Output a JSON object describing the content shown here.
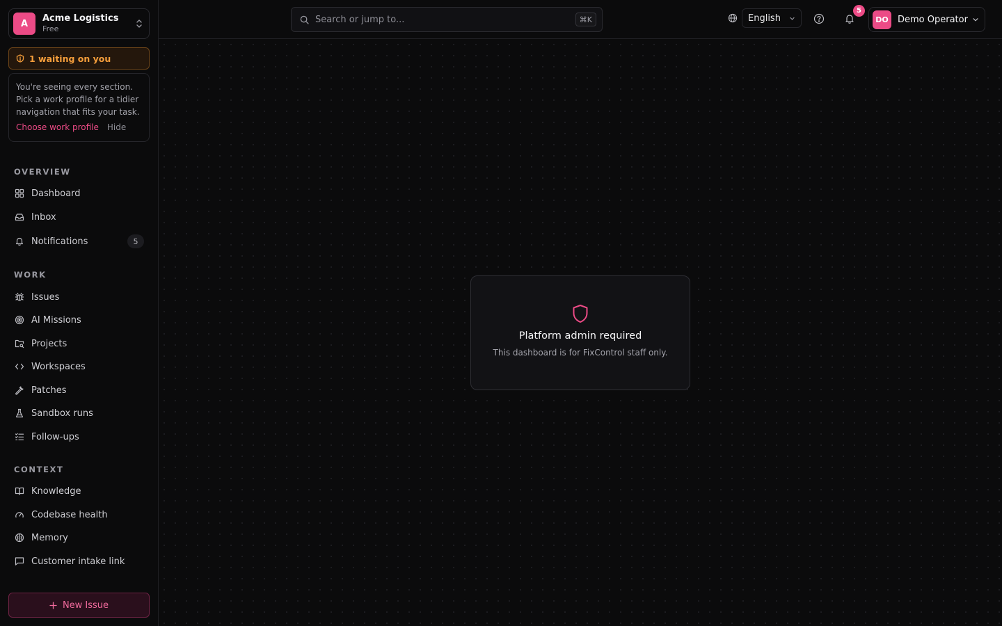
{
  "org": {
    "initial": "A",
    "name": "Acme Logistics",
    "plan": "Free"
  },
  "waiting": {
    "label": "1 waiting on you"
  },
  "profile_card": {
    "text": "You're seeing every section. Pick a work profile for a tidier navigation that fits your task.",
    "choose_label": "Choose work profile",
    "hide_label": "Hide"
  },
  "sections": {
    "overview": "OVERVIEW",
    "work": "WORK",
    "context": "CONTEXT"
  },
  "nav": {
    "dashboard": "Dashboard",
    "inbox": "Inbox",
    "notifications": "Notifications",
    "notifications_count": "5",
    "issues": "Issues",
    "ai_missions": "AI Missions",
    "projects": "Projects",
    "workspaces": "Workspaces",
    "patches": "Patches",
    "sandbox_runs": "Sandbox runs",
    "follow_ups": "Follow-ups",
    "knowledge": "Knowledge",
    "codebase_health": "Codebase health",
    "memory": "Memory",
    "customer_intake_link": "Customer intake link"
  },
  "new_issue": {
    "label": "New Issue"
  },
  "topbar": {
    "search_placeholder": "Search or jump to...",
    "search_shortcut": "⌘K",
    "language": "English",
    "notification_badge": "5",
    "user_initials": "DO",
    "user_name": "Demo Operator"
  },
  "notice": {
    "title": "Platform admin required",
    "text": "This dashboard is for FixControl staff only."
  },
  "colors": {
    "accent": "#ec4b86",
    "warning": "#f59e3b",
    "background": "#0b0b0c"
  }
}
